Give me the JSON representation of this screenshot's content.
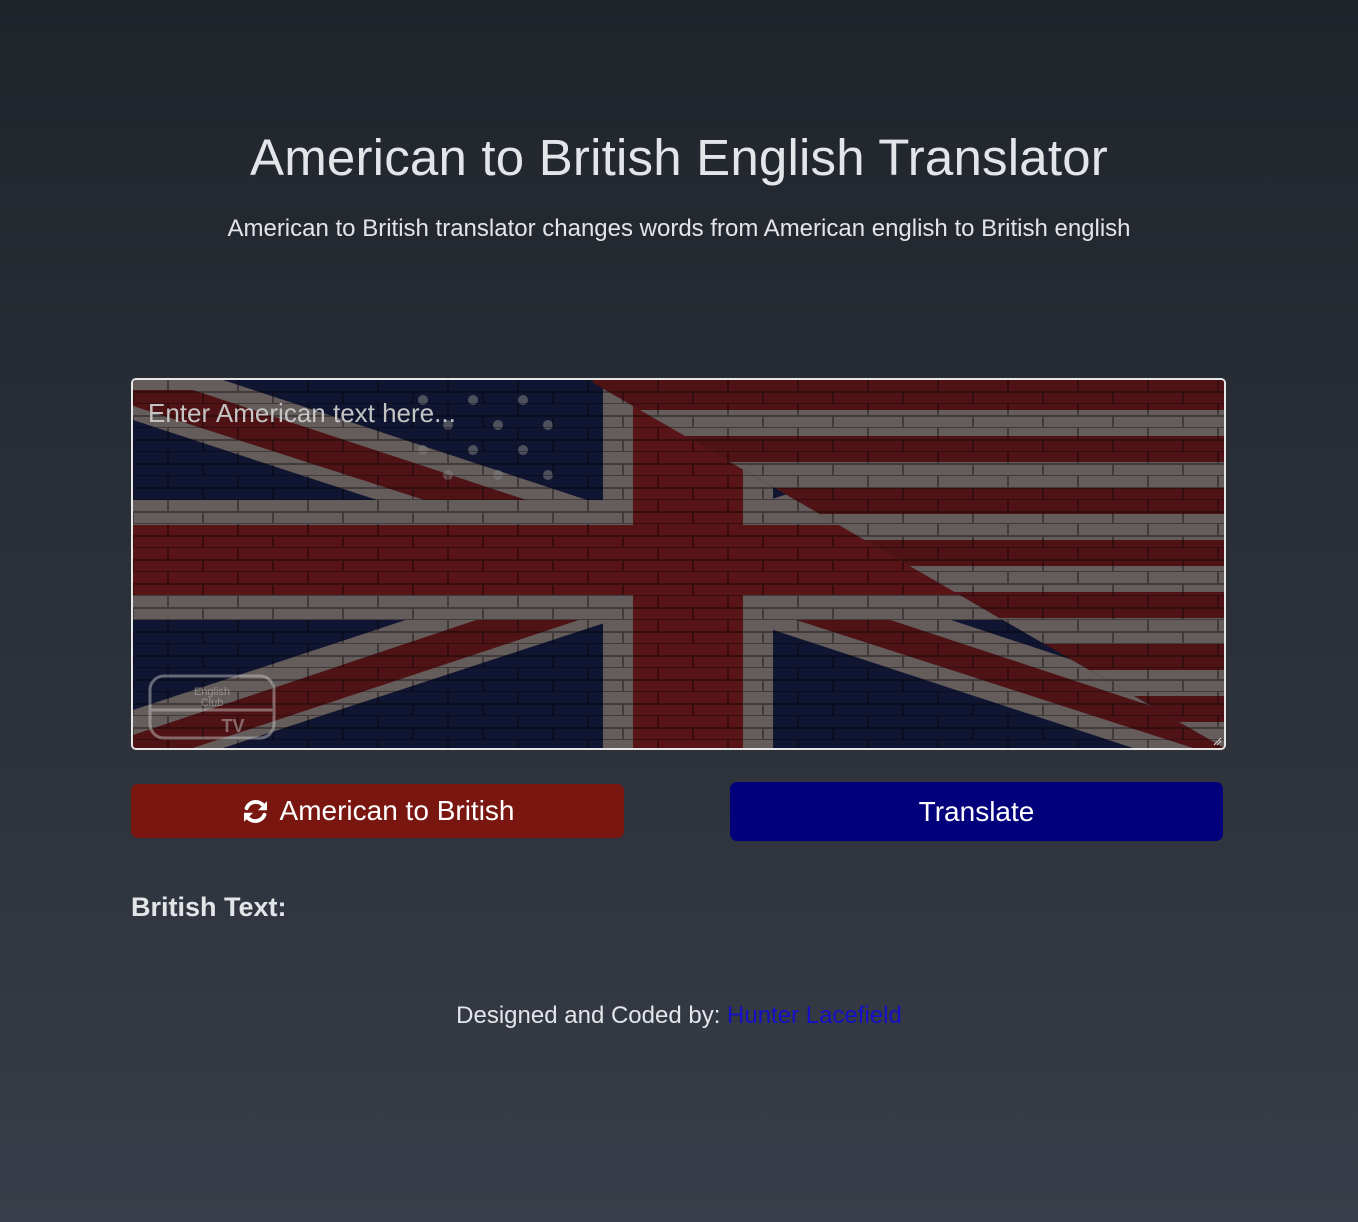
{
  "header": {
    "title": "American to British English Translator",
    "subtitle": "American to British translator changes words from American english to British english"
  },
  "input": {
    "placeholder": "Enter American text here...",
    "value": "",
    "background_image": "us-uk-flag-brick-wall-image",
    "watermark_text": [
      "English",
      "Club",
      "TV"
    ]
  },
  "buttons": {
    "toggle_label": "American to British",
    "toggle_icon": "sync-icon",
    "translate_label": "Translate"
  },
  "result": {
    "label": "British Text:",
    "value": ""
  },
  "footer": {
    "prefix": "Designed and Coded by: ",
    "author": "Hunter Lacefield"
  },
  "colors": {
    "background_top": "#20242b",
    "background_bottom": "#383e49",
    "toggle_button": "#7a1610",
    "translate_button": "#02007a",
    "author_link": "#1510c8",
    "text": "#e3e5e9"
  }
}
